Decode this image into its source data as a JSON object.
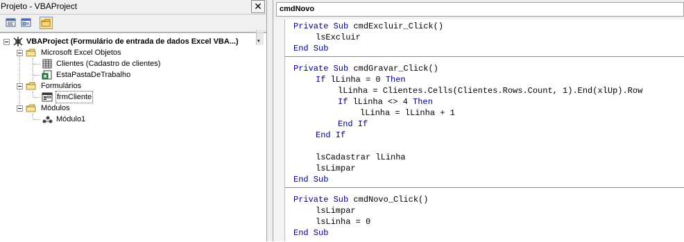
{
  "explorer": {
    "title": "Projeto - VBAProject",
    "close_label": "✕",
    "toolbar": {
      "view_code_icon": "view-code-icon",
      "view_object_icon": "view-object-icon",
      "toggle_folders_icon": "toggle-folders-icon"
    },
    "tree": {
      "project": "VBAProject (Formulário de entrada de dados Excel VBA...)",
      "folders": [
        {
          "label": "Microsoft Excel Objetos",
          "items": [
            "Clientes (Cadastro de clientes)",
            "EstaPastaDeTrabalho"
          ]
        },
        {
          "label": "Formulários",
          "items": [
            "frmCliente"
          ]
        },
        {
          "label": "Módulos",
          "items": [
            "Módulo1"
          ]
        }
      ]
    }
  },
  "code_window": {
    "object_combo": "cmdNovo",
    "procedures": [
      {
        "lines": [
          {
            "indent": 0,
            "kw": "Private Sub ",
            "rest": "cmdExcluir_Click()"
          },
          {
            "indent": 1,
            "kw": "",
            "rest": "lsExcluir"
          },
          {
            "indent": 0,
            "kw": "End Sub",
            "rest": ""
          }
        ]
      },
      {
        "lines": [
          {
            "indent": 0,
            "kw": "Private Sub ",
            "rest": "cmdGravar_Click()"
          },
          {
            "indent": 1,
            "kw": "If ",
            "rest": "lLinha = 0 ",
            "kw2": "Then"
          },
          {
            "indent": 2,
            "kw": "",
            "rest": "lLinha = Clientes.Cells(Clientes.Rows.Count, 1).End(xlUp).Row"
          },
          {
            "indent": 2,
            "kw": "If ",
            "rest": "lLinha <> 4 ",
            "kw2": "Then"
          },
          {
            "indent": 3,
            "kw": "",
            "rest": "lLinha = lLinha + 1"
          },
          {
            "indent": 2,
            "kw": "End If",
            "rest": ""
          },
          {
            "indent": 1,
            "kw": "End If",
            "rest": ""
          },
          {
            "indent": 0,
            "kw": "",
            "rest": ""
          },
          {
            "indent": 1,
            "kw": "",
            "rest": "lsCadastrar lLinha"
          },
          {
            "indent": 1,
            "kw": "",
            "rest": "lsLimpar"
          },
          {
            "indent": 0,
            "kw": "End Sub",
            "rest": ""
          }
        ]
      },
      {
        "lines": [
          {
            "indent": 0,
            "kw": "Private Sub ",
            "rest": "cmdNovo_Click()"
          },
          {
            "indent": 1,
            "kw": "",
            "rest": "lsLimpar"
          },
          {
            "indent": 1,
            "kw": "",
            "rest": "lsLinha = 0"
          },
          {
            "indent": 0,
            "kw": "End Sub",
            "rest": ""
          }
        ]
      }
    ]
  }
}
